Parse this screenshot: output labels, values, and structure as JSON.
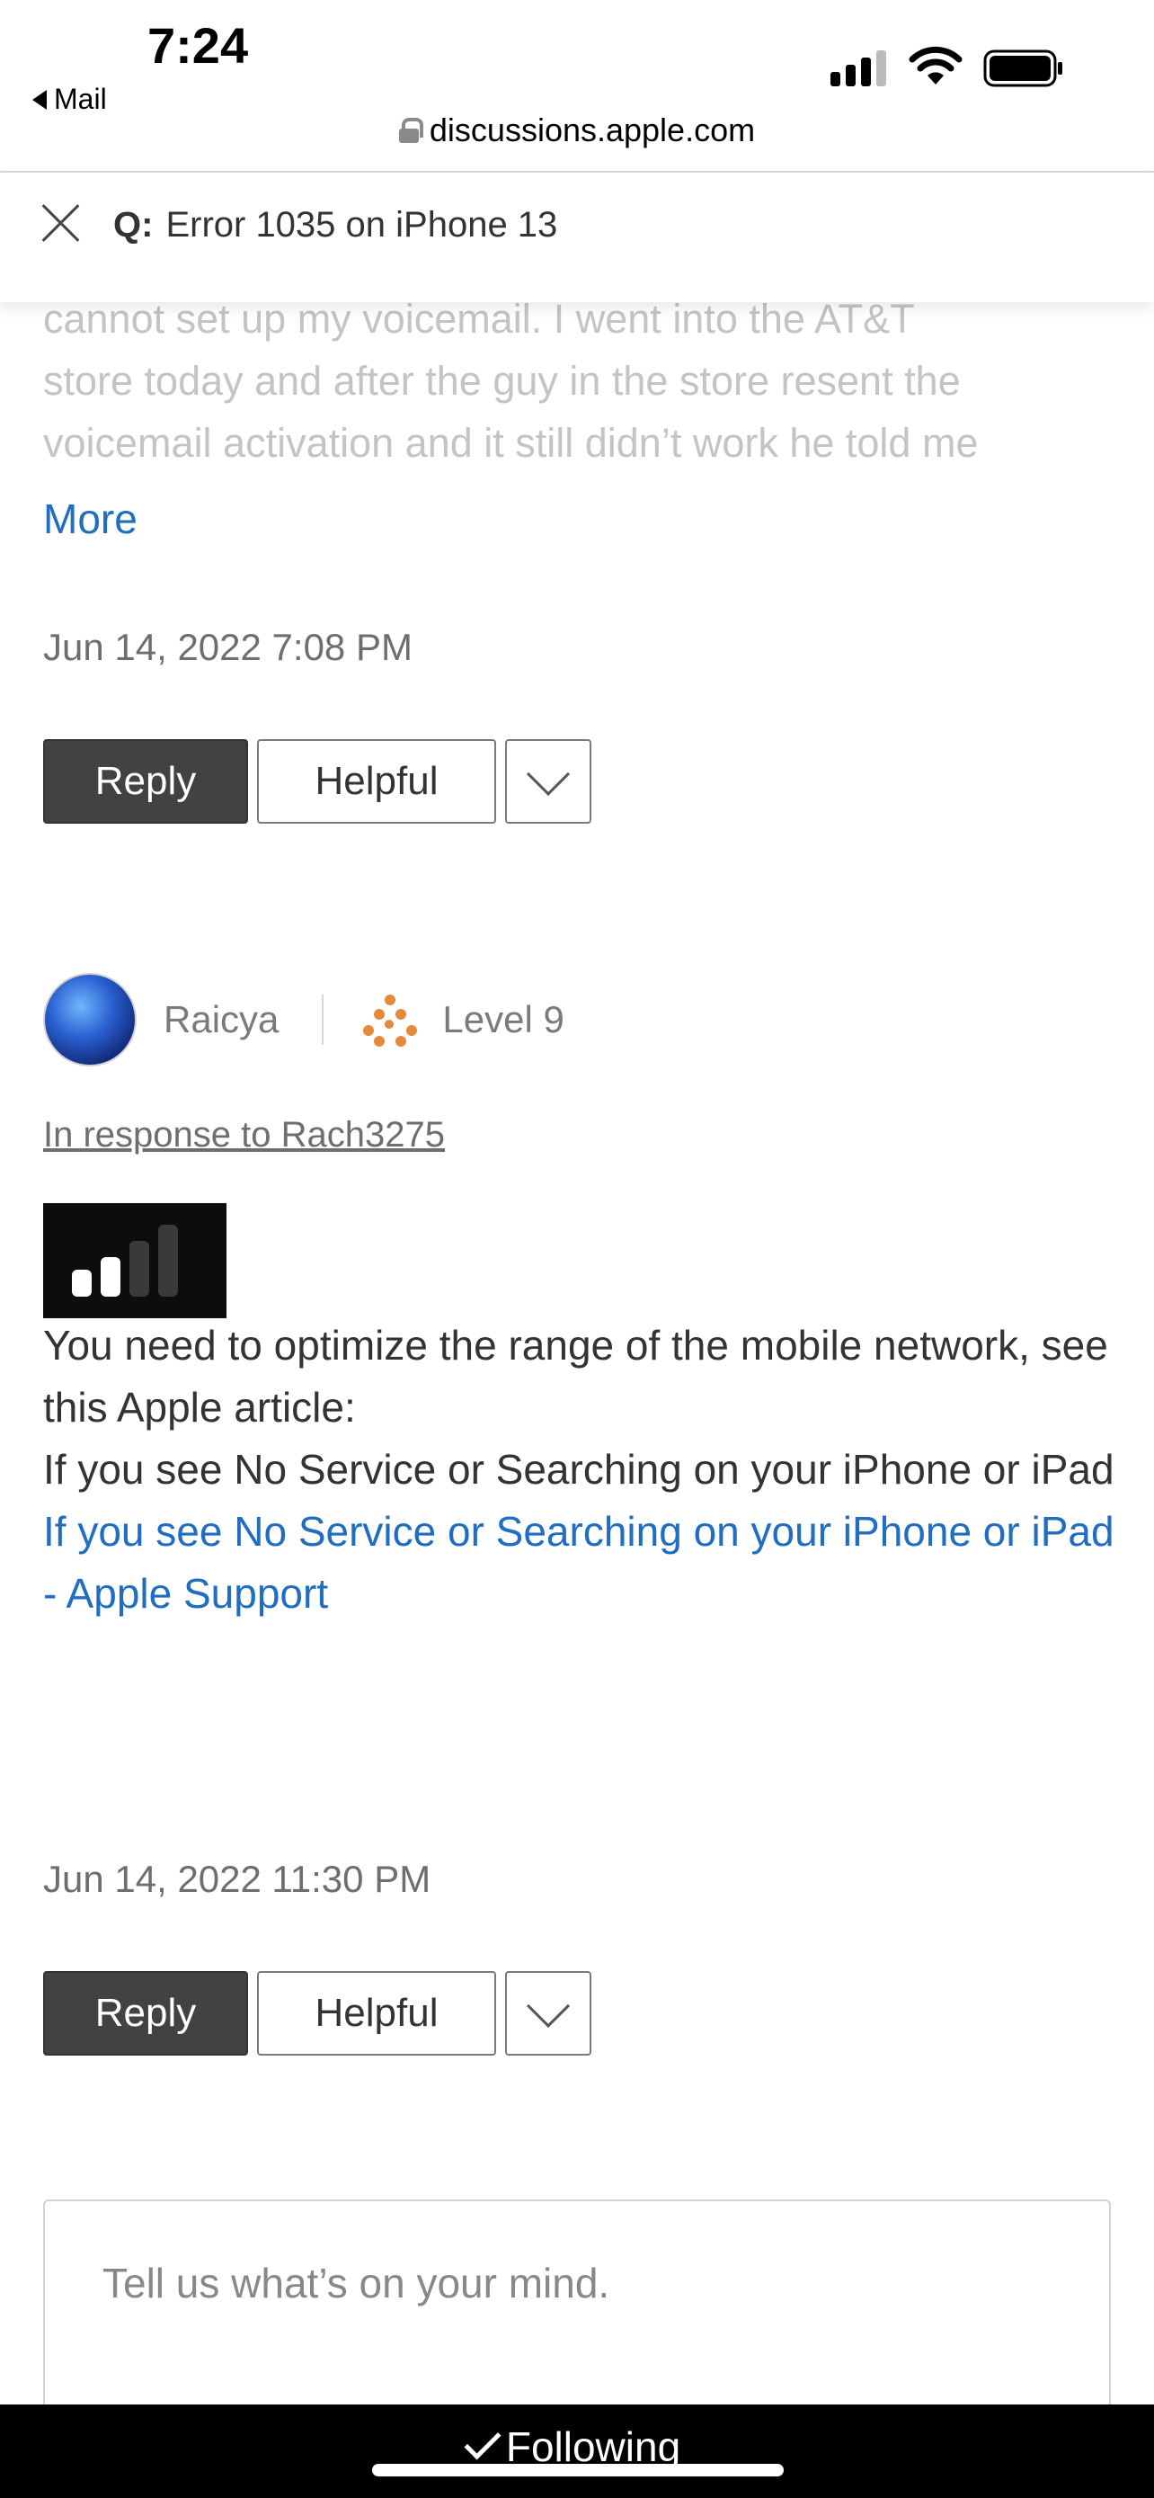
{
  "status_bar": {
    "time": "7:24",
    "back_app": "Mail",
    "url": "discussions.apple.com"
  },
  "question": {
    "prefix": "Q:",
    "title": "Error 1035 on iPhone 13"
  },
  "previous_post": {
    "faded_lines": [
      "cannot set up my voicemail. I went into the AT&T",
      "store today and after the guy in the store resent the",
      "voicemail activation and it still didn’t work he told me"
    ],
    "more_label": "More",
    "date": "Jun 14, 2022 7:08 PM",
    "reply_label": "Reply",
    "helpful_label": "Helpful"
  },
  "reply_post": {
    "author": "Raicya",
    "level": "Level 9",
    "in_response": "In response to Rach3275",
    "body_line1": "You need to optimize the range of the mobile network, see this Apple article:",
    "body_line2": "If you see No Service or Searching on your iPhone or iPad",
    "link_text": "If you see No Service or Searching on your iPhone or iPad - Apple Support",
    "date": "Jun 14, 2022 11:30 PM",
    "reply_label": "Reply",
    "helpful_label": "Helpful"
  },
  "composer": {
    "placeholder": "Tell us what’s on your mind."
  },
  "bottom_bar": {
    "following_label": "Following"
  },
  "colors": {
    "link": "#1f6ec2",
    "reply_button": "#424242",
    "level_icon": "#e38a3c"
  }
}
